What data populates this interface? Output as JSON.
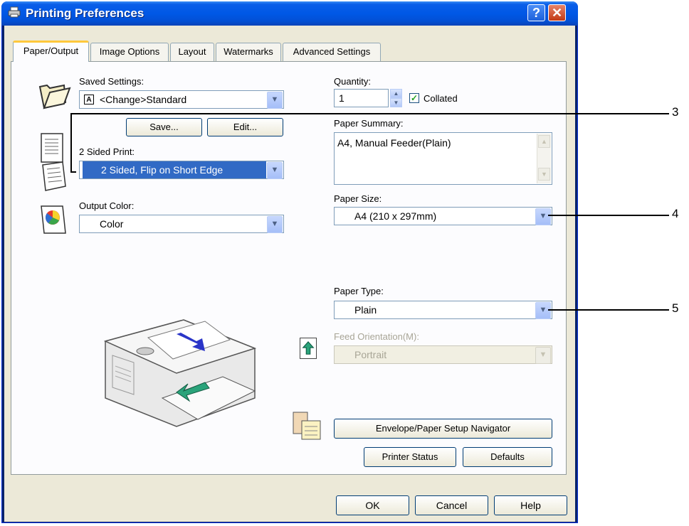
{
  "window": {
    "title": "Printing Preferences",
    "help_button": "?",
    "close_button": "✕"
  },
  "tabs": [
    "Paper/Output",
    "Image Options",
    "Layout",
    "Watermarks",
    "Advanced Settings"
  ],
  "saved_settings": {
    "label": "Saved Settings:",
    "value": "<Change>Standard",
    "save_button": "Save...",
    "edit_button": "Edit..."
  },
  "two_sided": {
    "label": "2 Sided Print:",
    "value": "2 Sided, Flip on Short Edge"
  },
  "output_color": {
    "label": "Output Color:",
    "value": "Color"
  },
  "quantity": {
    "label": "Quantity:",
    "value": "1",
    "collated_label": "Collated",
    "collated_checked": true
  },
  "paper_summary": {
    "label": "Paper Summary:",
    "value": "A4, Manual Feeder(Plain)"
  },
  "paper_size": {
    "label": "Paper Size:",
    "value": "A4 (210 x 297mm)"
  },
  "paper_type": {
    "label": "Paper Type:",
    "value": "Plain"
  },
  "feed_orientation": {
    "label": "Feed Orientation(M):",
    "value": "Portrait"
  },
  "buttons": {
    "envelope_navigator": "Envelope/Paper Setup Navigator",
    "printer_status": "Printer Status",
    "defaults": "Defaults",
    "ok": "OK",
    "cancel": "Cancel",
    "help": "Help"
  },
  "callouts": [
    "3",
    "4",
    "5"
  ],
  "colors": {
    "title_bar": "#0058e6",
    "dialog_bg": "#ece9d8",
    "selection": "#316ac5",
    "tab_highlight": "#ffc83c"
  }
}
